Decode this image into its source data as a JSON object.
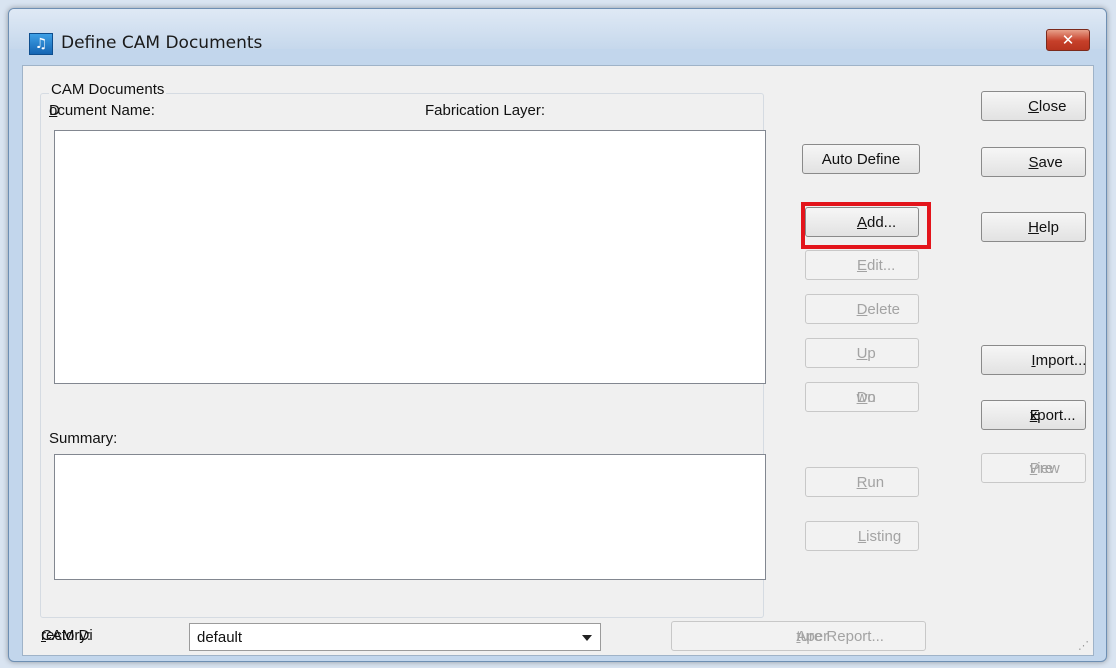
{
  "window": {
    "title": "Define CAM Documents",
    "close_glyph": "✕"
  },
  "cam_documents": {
    "group_title": "CAM Documents",
    "document_name_label_parts": [
      "D",
      "o",
      "cument Name:"
    ],
    "fabrication_layer_label": "Fabrication Layer:",
    "summary_label": "Summary:"
  },
  "buttons": {
    "auto_define": "Auto Define",
    "add": {
      "pre": "",
      "mn": "A",
      "post": "dd..."
    },
    "edit": {
      "pre": "",
      "mn": "E",
      "post": "dit..."
    },
    "delete": {
      "pre": "",
      "mn": "D",
      "post": "elete"
    },
    "up": {
      "pre": "",
      "mn": "U",
      "post": "p"
    },
    "down": {
      "pre": "Do",
      "mn": "w",
      "post": "n"
    },
    "run": {
      "pre": "",
      "mn": "R",
      "post": "un"
    },
    "listing": {
      "pre": "",
      "mn": "L",
      "post": "isting"
    },
    "close": {
      "pre": "",
      "mn": "C",
      "post": "lose"
    },
    "save": {
      "pre": "",
      "mn": "S",
      "post": "ave"
    },
    "help": {
      "pre": "",
      "mn": "H",
      "post": "elp"
    },
    "import": {
      "pre": "",
      "mn": "I",
      "post": "mport..."
    },
    "export": {
      "pre": "E",
      "mn": "x",
      "post": "port..."
    },
    "preview": {
      "pre": "Pre",
      "mn": "v",
      "post": "iew"
    },
    "aperture_report": {
      "pre": "Aper",
      "mn": "t",
      "post": "ure Report..."
    }
  },
  "cam_directory": {
    "label_parts": [
      "CAM Di",
      "r",
      "ectory:"
    ],
    "selected": "default"
  },
  "colors": {
    "highlight": "#e3141b"
  }
}
